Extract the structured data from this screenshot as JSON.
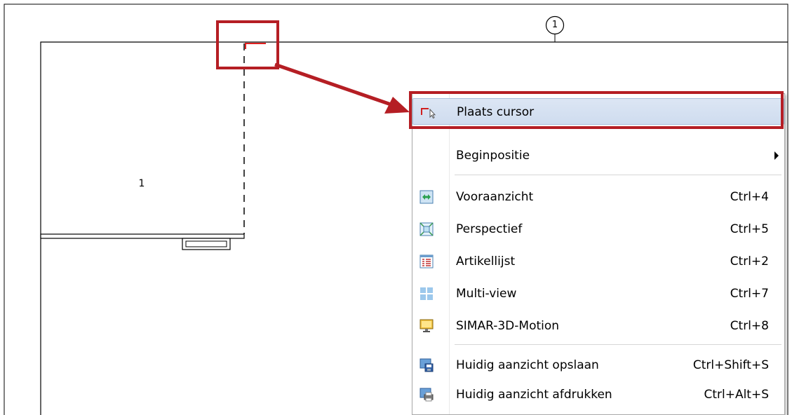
{
  "drawing": {
    "grid_marker": "1",
    "room_label": "1"
  },
  "context_menu": {
    "items": [
      {
        "label": "Plaats cursor",
        "shortcut": "",
        "icon": "place-cursor-icon",
        "highlighted": true
      },
      {
        "label": "Beginpositie",
        "shortcut": "",
        "icon": "",
        "submenu": true
      },
      {
        "label": "Vooraanzicht",
        "shortcut": "Ctrl+4",
        "icon": "front-view-icon"
      },
      {
        "label": "Perspectief",
        "shortcut": "Ctrl+5",
        "icon": "perspective-icon"
      },
      {
        "label": "Artikellijst",
        "shortcut": "Ctrl+2",
        "icon": "article-list-icon"
      },
      {
        "label": "Multi-view",
        "shortcut": "Ctrl+7",
        "icon": "multi-view-icon"
      },
      {
        "label": "SIMAR-3D-Motion",
        "shortcut": "Ctrl+8",
        "icon": "monitor-3d-icon"
      },
      {
        "label": "Huidig aanzicht opslaan",
        "shortcut": "Ctrl+Shift+S",
        "icon": "save-view-icon"
      },
      {
        "label": "Huidig aanzicht afdrukken",
        "shortcut": "Ctrl+Alt+S",
        "icon": "print-view-icon"
      }
    ]
  },
  "annotation": {
    "color": "#b51e24"
  }
}
